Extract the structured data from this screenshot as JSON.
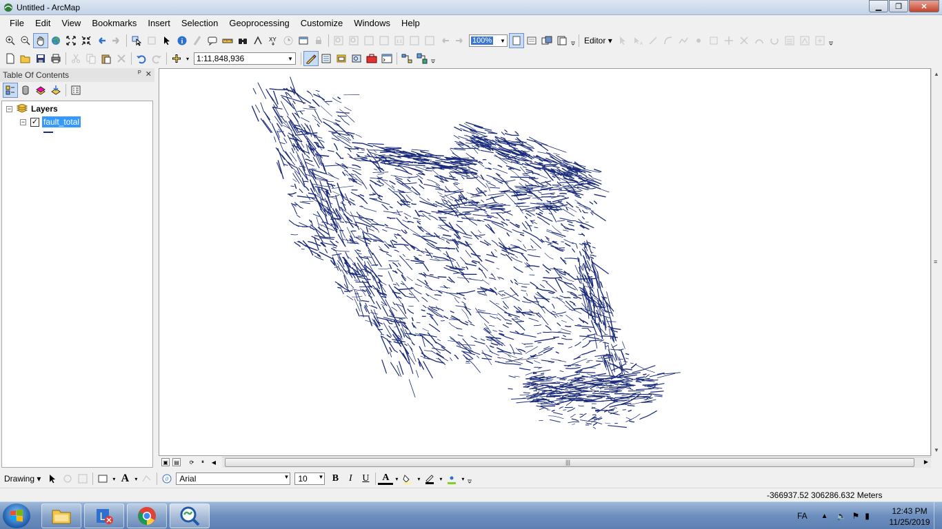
{
  "window": {
    "title": "Untitled - ArcMap",
    "minimize": "▁",
    "restore": "❐",
    "close": "✕"
  },
  "menu": [
    "File",
    "Edit",
    "View",
    "Bookmarks",
    "Insert",
    "Selection",
    "Geoprocessing",
    "Customize",
    "Windows",
    "Help"
  ],
  "toolbar": {
    "scale": "1:11,848,936",
    "zoom_percent": "100%",
    "editor_label": "Editor"
  },
  "toc": {
    "title": "Table Of Contents",
    "pin": "ᴾ",
    "close": "✕",
    "root_label": "Layers",
    "layer_name": "fault_total",
    "layer_checked": "✓",
    "expander": "−"
  },
  "drawing": {
    "label": "Drawing",
    "font_name": "Arial",
    "font_size": "10",
    "bold": "B",
    "italic": "I",
    "underline": "U",
    "font_color_letter": "A"
  },
  "status": {
    "coordinates": "-366937.52  306286.632 Meters"
  },
  "taskbar": {
    "language": "FA",
    "time": "12:43 PM",
    "date": "11/25/2019"
  },
  "colors": {
    "fault_lines": "#1a2b7a",
    "selection": "#3399ff"
  }
}
